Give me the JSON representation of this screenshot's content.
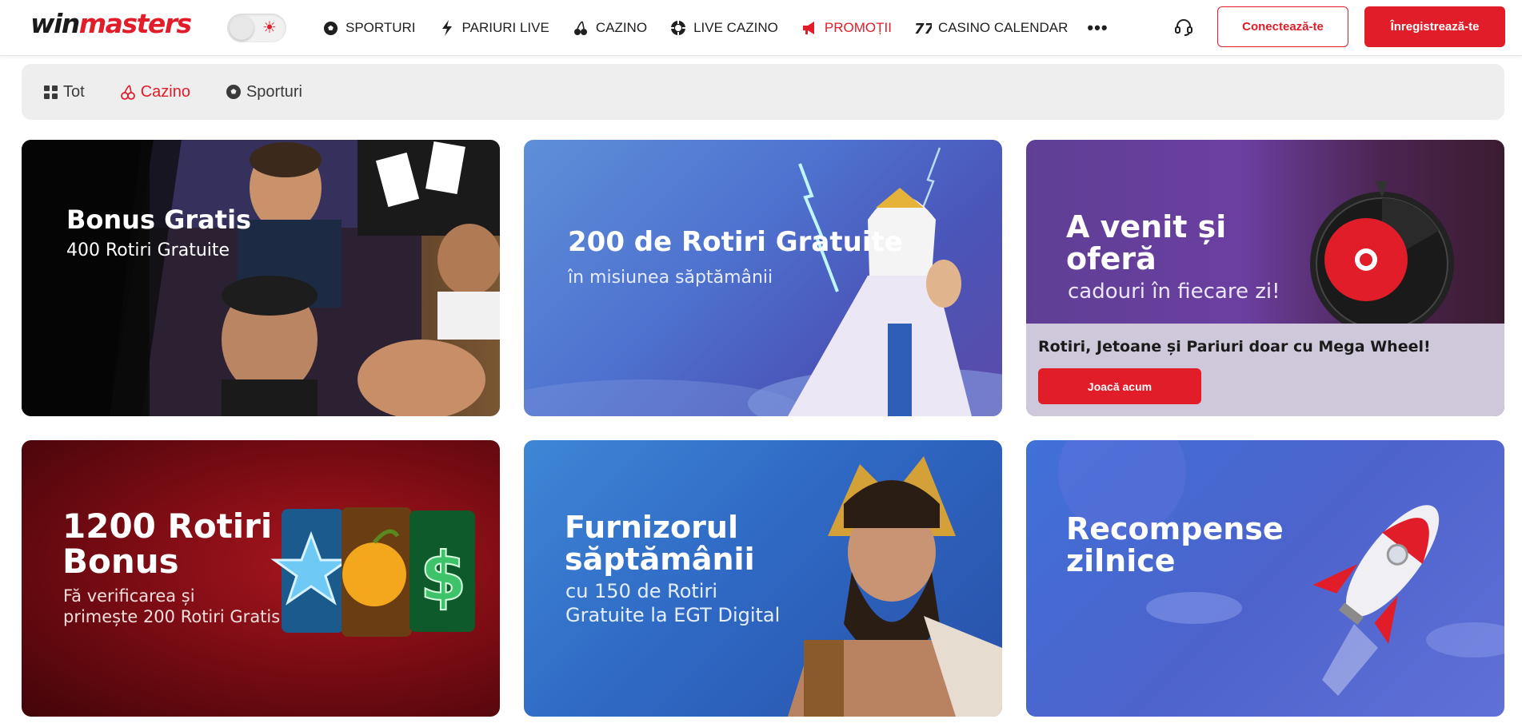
{
  "header": {
    "logo_win": "win",
    "logo_masters": "masters",
    "nav": [
      {
        "label": "SPORTURI",
        "icon": "soccer-ball-icon"
      },
      {
        "label": "PARIURI LIVE",
        "icon": "lightning-icon"
      },
      {
        "label": "CAZINO",
        "icon": "cherries-icon"
      },
      {
        "label": "LIVE CAZINO",
        "icon": "casino-chip-icon"
      },
      {
        "label": "PROMOȚII",
        "icon": "megaphone-icon",
        "active": true
      },
      {
        "label": "CASINO CALENDAR",
        "icon": "calendar-7-icon"
      }
    ],
    "more": "•••",
    "login_label": "Conectează-te",
    "register_label": "Înregistrează-te"
  },
  "filters": [
    {
      "label": "Tot",
      "icon": "grid-icon"
    },
    {
      "label": "Cazino",
      "icon": "cherries-icon",
      "active": true
    },
    {
      "label": "Sporturi",
      "icon": "soccer-ball-icon"
    }
  ],
  "promos": [
    {
      "title": "Bonus Gratis",
      "subtitle": "400 Rotiri Gratuite"
    },
    {
      "title": "200 de Rotiri Gratuite",
      "subtitle": "în misiunea săptămânii"
    },
    {
      "title_line1": "A venit și",
      "title_line2": "oferă",
      "subtitle": "cadouri în fiecare zi!",
      "panel_text": "Rotiri, Jetoane și Pariuri doar cu Mega Wheel!",
      "cta": "Joacă acum"
    },
    {
      "title_line1": "1200 Rotiri",
      "title_line2": "Bonus",
      "subtitle_line1": "Fă verificarea și",
      "subtitle_line2": "primește 200 Rotiri Gratis"
    },
    {
      "title_line1": "Furnizorul",
      "title_line2": "săptămânii",
      "subtitle_line1": "cu 150 de Rotiri",
      "subtitle_line2": "Gratuite la EGT Digital"
    },
    {
      "title_line1": "Recompense",
      "title_line2": "zilnice"
    }
  ],
  "colors": {
    "brand_red": "#e11d2a",
    "text_dark": "#1f1f1f",
    "filter_bg": "#eeeeee"
  }
}
